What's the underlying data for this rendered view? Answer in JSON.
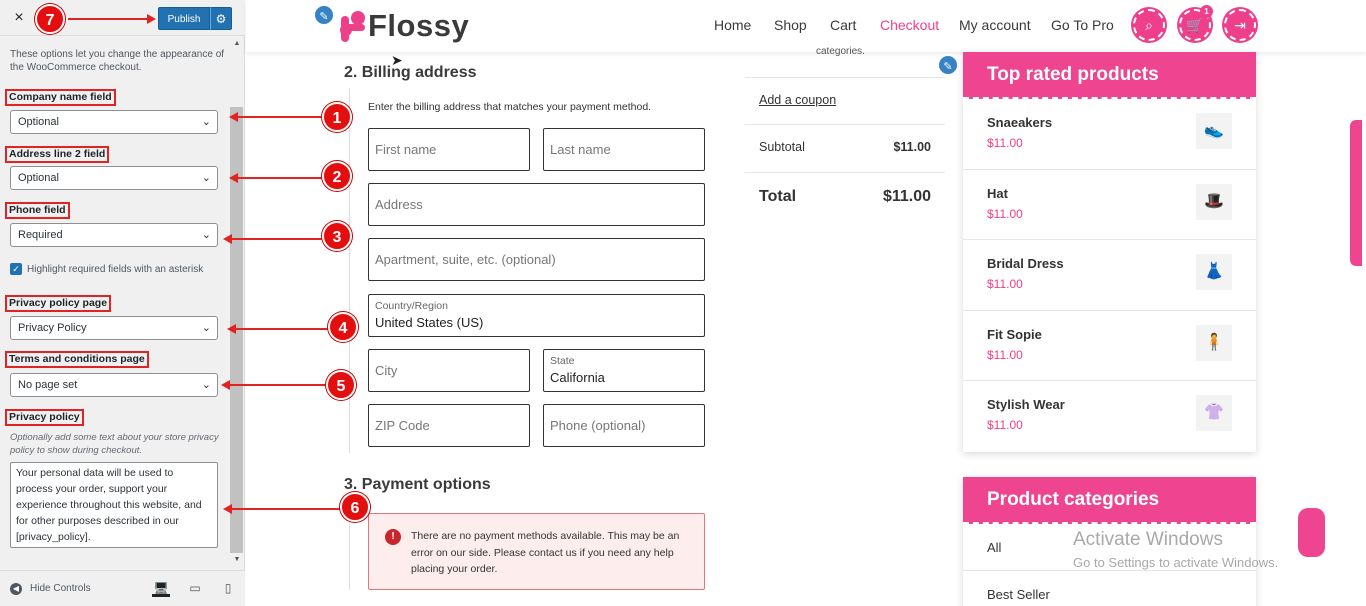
{
  "customizer": {
    "close_icon": "×",
    "publish_label": "Publish",
    "gear_icon": "⚙",
    "description": "These options let you change the appearance of the WooCommerce checkout.",
    "company_field": {
      "label": "Company name field",
      "value": "Optional"
    },
    "address2_field": {
      "label": "Address line 2 field",
      "value": "Optional"
    },
    "phone_field": {
      "label": "Phone field",
      "value": "Required"
    },
    "highlight_checkbox": {
      "label": "Highlight required fields with an asterisk",
      "checked": true
    },
    "privacy_page": {
      "label": "Privacy policy page",
      "value": "Privacy Policy"
    },
    "terms_page": {
      "label": "Terms and conditions page",
      "value": "No page set"
    },
    "privacy_policy": {
      "label": "Privacy policy",
      "help": "Optionally add some text about your store privacy policy to show during checkout.",
      "text": "Your personal data will be used to process your order, support your experience throughout this website, and for other purposes described in our [privacy_policy]."
    },
    "hide_controls": "Hide Controls"
  },
  "annotations": [
    "1",
    "2",
    "3",
    "4",
    "5",
    "6",
    "7"
  ],
  "site": {
    "logo": "Flossy",
    "nav": [
      "Home",
      "Shop",
      "Cart",
      "Checkout",
      "My account",
      "Go To Pro"
    ],
    "active_nav": "Checkout",
    "cart_count": "1",
    "accent_color": "#ef3f8a"
  },
  "billing": {
    "title": "2.  Billing address",
    "intro": "Enter the billing address that matches your payment method.",
    "first_name": "First name",
    "last_name": "Last name",
    "address": "Address",
    "apartment": "Apartment, suite, etc. (optional)",
    "country_label": "Country/Region",
    "country_value": "United States (US)",
    "city": "City",
    "state_label": "State",
    "state_value": "California",
    "zip": "ZIP Code",
    "phone": "Phone (optional)"
  },
  "payment": {
    "title": "3.  Payment options",
    "notice": "There are no payment methods available. This may be an error on our side. Please contact us if you need any help placing your order."
  },
  "summary": {
    "categories_cut": "categories.",
    "coupon": "Add a coupon",
    "subtotal_label": "Subtotal",
    "subtotal_value": "$11.00",
    "total_label": "Total",
    "total_value": "$11.00"
  },
  "top_rated": {
    "title": "Top rated products",
    "products": [
      {
        "name": "Snaeakers",
        "price": "$11.00",
        "icon": "shoe-icon"
      },
      {
        "name": "Hat",
        "price": "$11.00",
        "icon": "hat-icon"
      },
      {
        "name": "Bridal Dress",
        "price": "$11.00",
        "icon": "dress-icon"
      },
      {
        "name": "Fit Sopie",
        "price": "$11.00",
        "icon": "outfit-icon"
      },
      {
        "name": "Stylish Wear",
        "price": "$11.00",
        "icon": "wear-icon"
      }
    ]
  },
  "categories": {
    "title": "Product categories",
    "items": [
      "All",
      "Best Seller"
    ]
  },
  "watermark": {
    "line1": "Activate Windows",
    "line2": "Go to Settings to activate Windows."
  }
}
